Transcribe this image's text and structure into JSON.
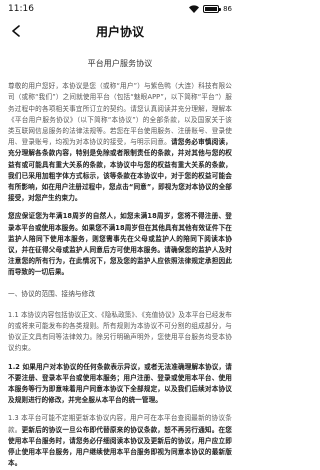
{
  "status_bar": {
    "time": "11:16",
    "battery_level": "86",
    "battery_fill": 0.86
  },
  "header": {
    "title": "用户协议"
  },
  "document": {
    "title": "平台用户服务协议",
    "intro_normal": "尊敬的用户您好，本协议是您（或称“用户”）与紫色鸭（大连）科技有限公司（或称“我们”）之间就使用平台（包括“魅眼APP”，以下简称“平台”）服务过程中的各项相关事宜所订立的契约。请您认真阅读并充分理解，理解本《平台用户服务协议》（以下简称“本协议”）的全部条款，以及国家关于该类互联网信息服务的法律法规等。若您在平台使用服务、注册账号、登录使用、登录账号，均视为对本协议的接受，与明示同意。",
    "intro_bold": "请您务必审慎阅读，充分理解各条款内容，特别是免除或者限制责任的条款，并对其他与您的权益有或可能具有重大关系的条款，本协议中与您的权益有重大关系的条款，我们已采用加粗字体方式标示，该等条款在本协议中，对于您的权益可能会有所影响，如在用户注册过程中，您点击“同意”，即视为您对本协议的全部接受，对您产生约束力。",
    "minor_bold": "您应保证您为年满18周岁的自然人，如您未满18周岁，您将不得注册、登录本平台或使用本服务。如果您不满18周岁但在其他具有其他有效证件下在监护人陪同下使用本服务，则您需事先在父母或监护人的陪同下阅读本协议，并在征得父母或监护人同意后方可使用本服务。请确保您的监护人及时注意您的所有行为，在此情况下，您及您的监护人应依照法律规定承担因此而导致的一切后果。",
    "section1_heading": "一、协议的范围、接纳与修改",
    "p11_normal": "1.1 本协议内容包括协议正文、《隐私政策》、《充值协议》及本平台已经发布的或将来可能发布的各类规则。所有规则为本协议不可分割的组成部分，与协议正文具有同等法律效力。除另行明确声明外，您使用平台服务均受本协议约束。",
    "p12_bold": "1.2 如果用户对本协议的任何条款表示异议，或者无法准确理解本协议，请不要注册、登录本平台或使用本服务；用户注册、登录或使用本平台、使用本服务等行为即意味着用户同意本协议下全部规定，以及我们后续对本协议及规则进行的修改，并完全服从本平台的统一管理。",
    "p13_normal": "1.3 本平台可能不定期更新本协议内容，用户可在本平台查阅最新的协议条款。",
    "p13_bold": "更新后的协议一旦公布即代替原来的协议条款，恕不再另行通知。在您使用本平台服务时，请您务必仔细阅读本协议及更新后的协议，用户应立即停止使用本平台服务，用户继续使用本平台服务即视为同意本协议的最新版本。"
  }
}
